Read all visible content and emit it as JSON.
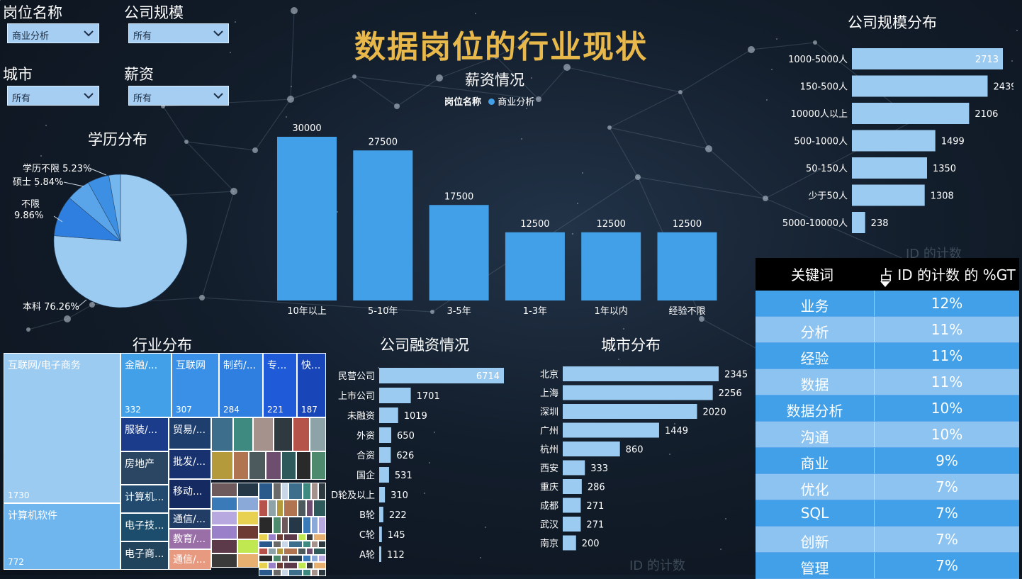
{
  "header": {
    "title": "数据岗位的行业现状"
  },
  "filters": [
    {
      "label": "岗位名称",
      "value": "商业分析"
    },
    {
      "label": "公司规模",
      "value": "所有"
    },
    {
      "label": "城市",
      "value": "所有"
    },
    {
      "label": "薪资",
      "value": "所有"
    }
  ],
  "charts": {
    "education": {
      "title": "学历分布"
    },
    "salary": {
      "title": "薪资情况",
      "legend_title": "岗位名称",
      "legend_item": "商业分析"
    },
    "company_size": {
      "title": "公司规模分布"
    },
    "industry": {
      "title": "行业分布"
    },
    "financing": {
      "title": "公司融资情况"
    },
    "city": {
      "title": "城市分布"
    }
  },
  "keyword_table": {
    "col1": "关键词",
    "col2": "占 ID 的计数 的 %GT",
    "rows": [
      {
        "k": "业务",
        "p": "12%"
      },
      {
        "k": "分析",
        "p": "11%"
      },
      {
        "k": "经验",
        "p": "11%"
      },
      {
        "k": "数据",
        "p": "11%"
      },
      {
        "k": "数据分析",
        "p": "10%"
      },
      {
        "k": "沟通",
        "p": "10%"
      },
      {
        "k": "商业",
        "p": "9%"
      },
      {
        "k": "优化",
        "p": "7%"
      },
      {
        "k": "SQL",
        "p": "7%"
      },
      {
        "k": "创新",
        "p": "7%"
      },
      {
        "k": "管理",
        "p": "7%"
      }
    ]
  },
  "faint_texts": {
    "behind_table": "ID 的计数",
    "bottom": "ID 的计数"
  },
  "colors": {
    "accent": "#41a0e8",
    "light_bar": "#9ccbf2",
    "title": "#e8b84a"
  },
  "chart_data": [
    {
      "type": "pie",
      "title": "学历分布",
      "labels": [
        "本科 76.26%",
        "不限 9.86%",
        "硕士 5.84%",
        "学历不限 5.23%"
      ],
      "values": [
        76.26,
        9.86,
        5.84,
        5.23,
        2.81
      ],
      "colors": [
        "#9ccbf2",
        "#2f7fe0",
        "#5aa4ea",
        "#3d8fe4",
        "#74b6ee"
      ]
    },
    {
      "type": "bar",
      "title": "薪资情况",
      "categories": [
        "10年以上",
        "5-10年",
        "3-5年",
        "1-3年",
        "1年以内",
        "经验不限"
      ],
      "series": [
        {
          "name": "商业分析",
          "values": [
            30000,
            27500,
            17500,
            12500,
            12500,
            12500
          ]
        }
      ]
    },
    {
      "type": "bar",
      "orientation": "horizontal",
      "title": "公司规模分布",
      "categories": [
        "1000-5000人",
        "150-500人",
        "10000人以上",
        "500-1000人",
        "50-150人",
        "少于50人",
        "5000-10000人"
      ],
      "values": [
        2713,
        2439,
        2106,
        1499,
        1350,
        1308,
        238
      ]
    },
    {
      "type": "bar",
      "orientation": "horizontal",
      "title": "公司融资情况",
      "categories": [
        "民营公司",
        "上市公司",
        "未融资",
        "外资",
        "合资",
        "国企",
        "D轮及以上",
        "B轮",
        "C轮",
        "A轮"
      ],
      "values": [
        6714,
        1701,
        1019,
        650,
        626,
        531,
        310,
        222,
        145,
        112
      ]
    },
    {
      "type": "bar",
      "orientation": "horizontal",
      "title": "城市分布",
      "categories": [
        "北京",
        "上海",
        "深圳",
        "广州",
        "杭州",
        "西安",
        "重庆",
        "成都",
        "武汉",
        "南京"
      ],
      "values": [
        2345,
        2256,
        2020,
        1449,
        860,
        333,
        286,
        271,
        271,
        200
      ]
    },
    {
      "type": "treemap",
      "title": "行业分布",
      "items": [
        {
          "name": "互联网/电子商务",
          "value": 1730
        },
        {
          "name": "计算机软件",
          "value": 772
        },
        {
          "name": "金融/...",
          "value": 332
        },
        {
          "name": "互联网",
          "value": 307
        },
        {
          "name": "制药/...",
          "value": 284
        },
        {
          "name": "专...",
          "value": 221
        },
        {
          "name": "快...",
          "value": 187
        },
        {
          "name": "服装/..."
        },
        {
          "name": "房地产"
        },
        {
          "name": "计算机..."
        },
        {
          "name": "电子技..."
        },
        {
          "name": "电子商..."
        },
        {
          "name": "贸易/..."
        },
        {
          "name": "批发/..."
        },
        {
          "name": "移动..."
        },
        {
          "name": "通信/..."
        },
        {
          "name": "教育/..."
        },
        {
          "name": "通信/..."
        }
      ]
    }
  ]
}
